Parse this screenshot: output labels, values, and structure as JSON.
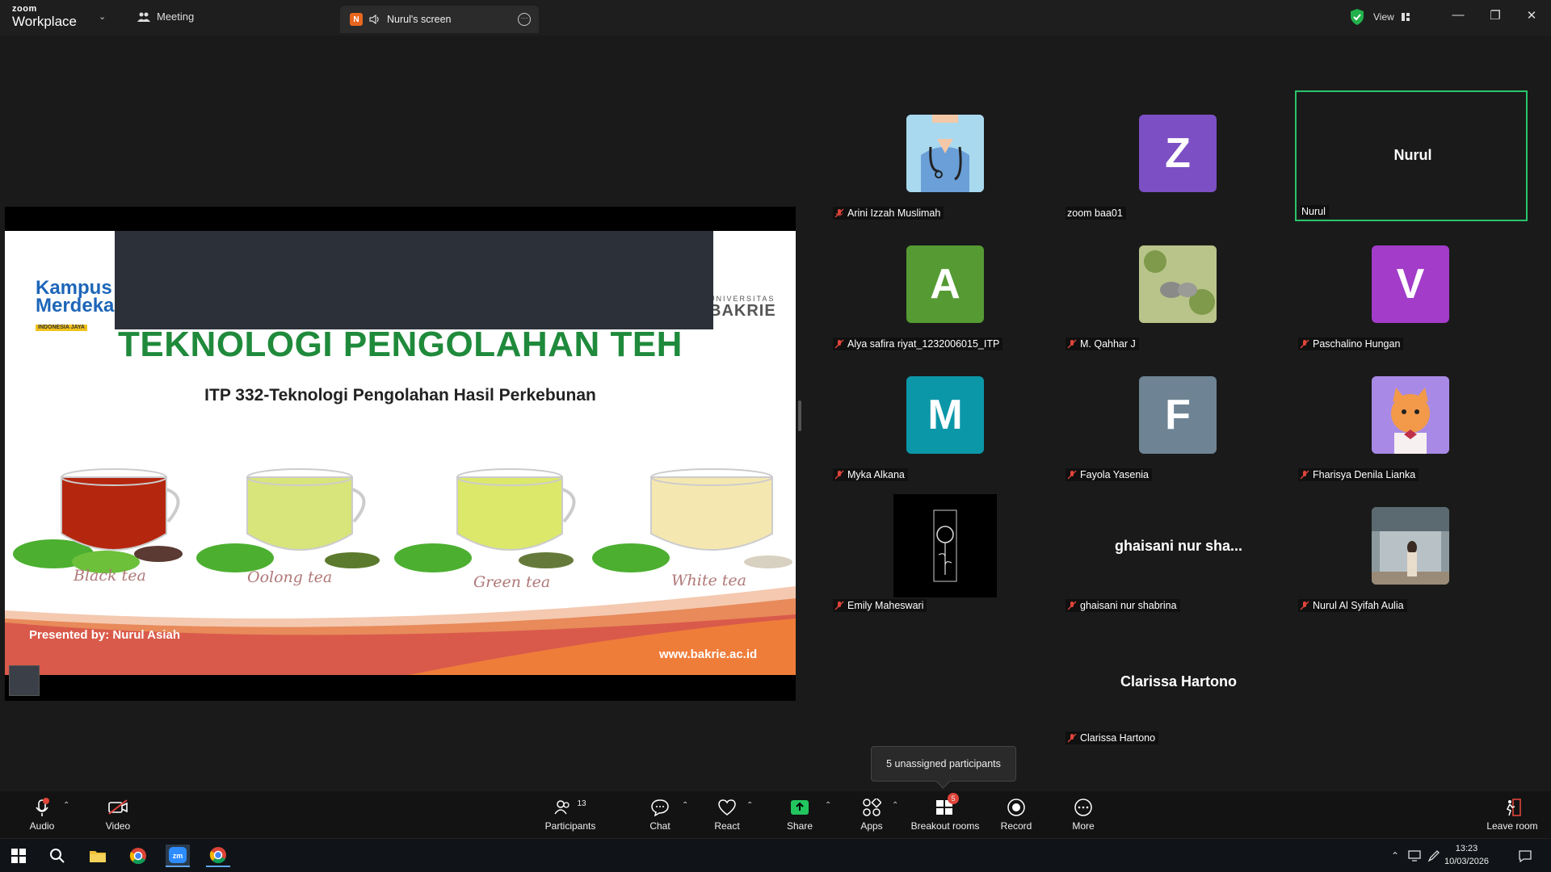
{
  "app": {
    "brand_top": "zoom",
    "brand_bottom": "Workplace"
  },
  "tabs": {
    "meeting": "Meeting",
    "screen_badge": "N",
    "screen": "Nurul's screen"
  },
  "header": {
    "view_label": "View"
  },
  "slide": {
    "logo_left": "Kampus Merdeka",
    "logo_left_sub": "INDONESIA JAYA",
    "logo_right_top": "UNIVERSITAS",
    "logo_right_bottom": "BAKRIE",
    "title": "TEKNOLOGI PENGOLAHAN TEH",
    "subtitle": "ITP 332-Teknologi Pengolahan Hasil Perkebunan",
    "teas": [
      "Black tea",
      "Oolong tea",
      "Green tea",
      "White tea"
    ],
    "presented": "Presented by: Nurul Asiah",
    "website": "www.bakrie.ac.id"
  },
  "participants": [
    {
      "name": "Arini Izzah Muslimah",
      "avatar": "doctor-image",
      "muted": true
    },
    {
      "name": "zoom baa01",
      "letter": "Z",
      "color": "#7c4fc4",
      "muted": false
    },
    {
      "name": "Nurul",
      "big": "Nurul",
      "muted": false,
      "active": true
    },
    {
      "name": "Alya safira riyat_1232006015_ITP",
      "letter": "A",
      "color": "#559a33",
      "muted": true
    },
    {
      "name": "M. Qahhar J",
      "avatar": "elephant-image",
      "muted": true
    },
    {
      "name": "Paschalino Hungan",
      "letter": "V",
      "color": "#a23cc9",
      "muted": true
    },
    {
      "name": "Myka Alkana",
      "letter": "M",
      "color": "#0b97a8",
      "muted": true
    },
    {
      "name": "Fayola Yasenia",
      "letter": "F",
      "color": "#6e8494",
      "muted": true
    },
    {
      "name": "Fharisya Denila Lianka",
      "avatar": "cat-image",
      "muted": true
    },
    {
      "name": "Emily Maheswari",
      "avatar": "rose-image",
      "muted": true
    },
    {
      "name": "ghaisani nur shabrina",
      "big": "ghaisani nur sha...",
      "muted": true
    },
    {
      "name": "Nurul Al Syifah Aulia",
      "avatar": "photo-image",
      "muted": true
    },
    {
      "name": "Clarissa Hartono",
      "big": "Clarissa Hartono",
      "muted": true
    }
  ],
  "tooltip": "5 unassigned participants",
  "toolbar": {
    "audio": "Audio",
    "video": "Video",
    "participants": "Participants",
    "participants_count": "13",
    "chat": "Chat",
    "react": "React",
    "share": "Share",
    "apps": "Apps",
    "breakout": "Breakout rooms",
    "breakout_badge": "5",
    "record": "Record",
    "more": "More",
    "leave": "Leave room"
  },
  "taskbar": {
    "time": "13:23",
    "date": "10/03/2026"
  }
}
